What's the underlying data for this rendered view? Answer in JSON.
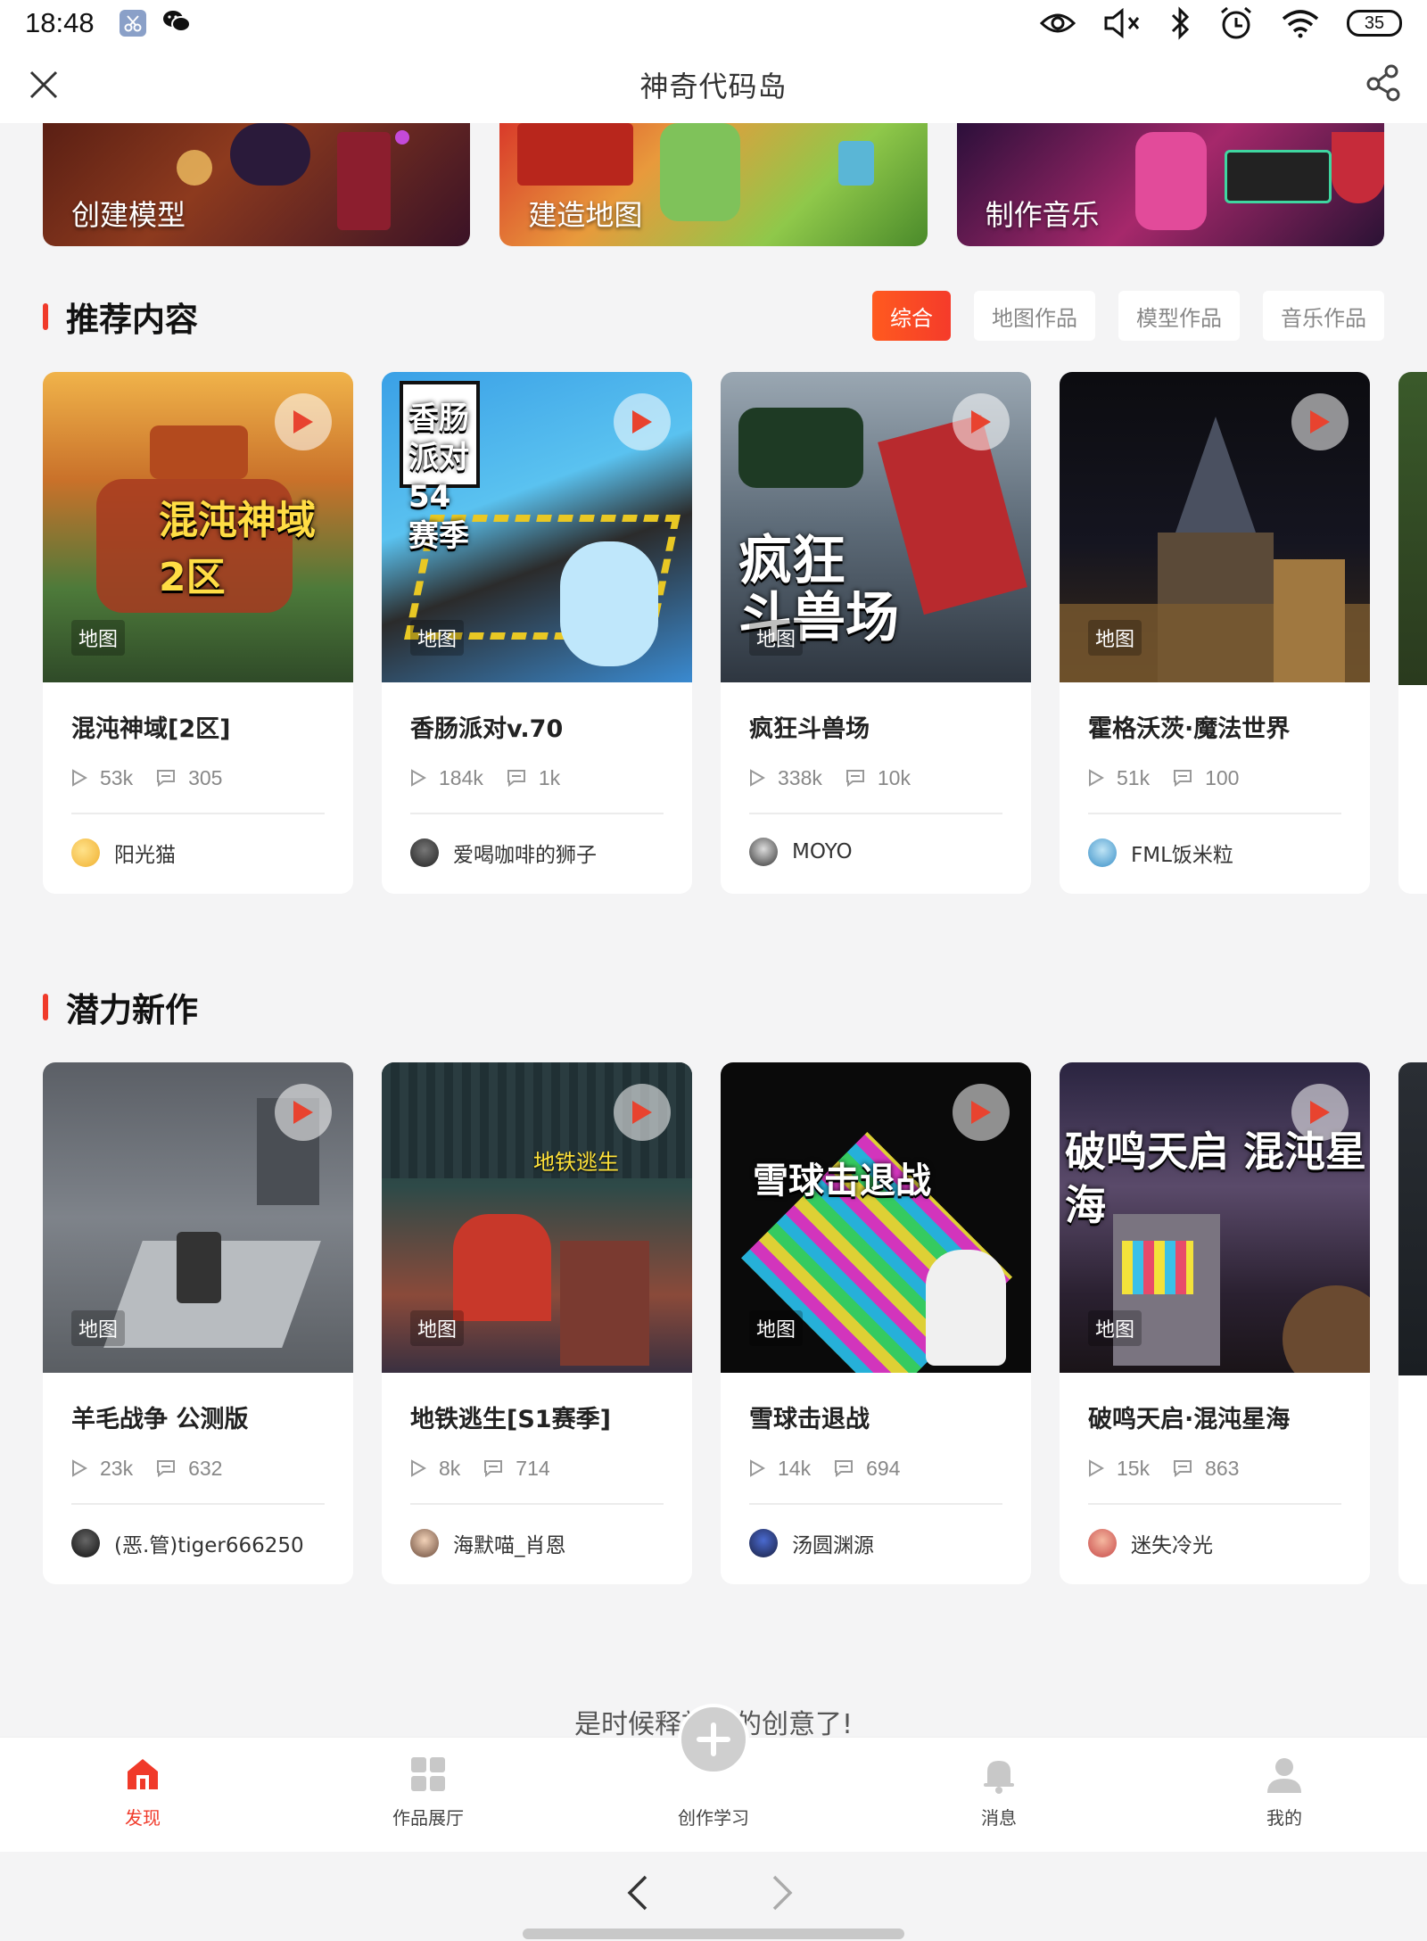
{
  "status_bar": {
    "time": "18:48",
    "battery": "35"
  },
  "header": {
    "title": "神奇代码岛"
  },
  "banners": [
    {
      "label": "创建模型"
    },
    {
      "label": "建造地图"
    },
    {
      "label": "制作音乐"
    }
  ],
  "recommended": {
    "title": "推荐内容",
    "filters": [
      "综合",
      "地图作品",
      "模型作品",
      "音乐作品"
    ],
    "active_filter": "综合",
    "cards": [
      {
        "tag": "地图",
        "title": "混沌神域[2区]",
        "plays": "53k",
        "comments": "305",
        "author": "阳光猫",
        "overlay": "混沌神域 2区"
      },
      {
        "tag": "地图",
        "title": "香肠派对v.70",
        "plays": "184k",
        "comments": "1k",
        "author": "爱喝咖啡的狮子",
        "overlay": "香肠派对 54赛季"
      },
      {
        "tag": "地图",
        "title": "疯狂斗兽场",
        "plays": "338k",
        "comments": "10k",
        "author": "MOYO",
        "overlay": "疯狂 斗兽场"
      },
      {
        "tag": "地图",
        "title": "霍格沃茨·魔法世界",
        "plays": "51k",
        "comments": "100",
        "author": "FML饭米粒",
        "overlay": ""
      }
    ]
  },
  "potential": {
    "title": "潜力新作",
    "cards": [
      {
        "tag": "地图",
        "title": "羊毛战争 公测版",
        "plays": "23k",
        "comments": "632",
        "author": "(恶.管)tiger666250",
        "overlay": ""
      },
      {
        "tag": "地图",
        "title": "地铁逃生[S1赛季]",
        "plays": "8k",
        "comments": "714",
        "author": "海默喵_肖恩",
        "overlay": "地铁逃生"
      },
      {
        "tag": "地图",
        "title": "雪球击退战",
        "plays": "14k",
        "comments": "694",
        "author": "汤圆渊源",
        "overlay": "雪球击退战"
      },
      {
        "tag": "地图",
        "title": "破鸣天启·混沌星海",
        "plays": "15k",
        "comments": "863",
        "author": "迷失冷光",
        "overlay": "破鸣天启 混沌星海"
      }
    ]
  },
  "footer_hint": "是时候释放你的创意了!",
  "bottom_nav": [
    {
      "label": "发现",
      "icon": "home-icon",
      "active": true
    },
    {
      "label": "作品展厅",
      "icon": "grid-icon"
    },
    {
      "label": "创作学习",
      "icon": "plus-icon"
    },
    {
      "label": "消息",
      "icon": "bell-icon"
    },
    {
      "label": "我的",
      "icon": "user-icon"
    }
  ],
  "colors": {
    "accent": "#f03a2a",
    "accent_gradient_start": "#ff5a1f"
  }
}
